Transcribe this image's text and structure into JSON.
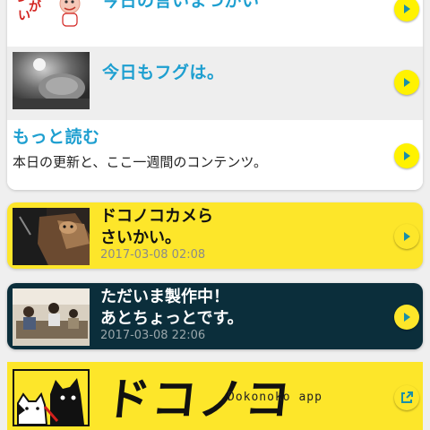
{
  "colors": {
    "accent_blue": "#1e9fd0",
    "brand_yellow": "#fde62a",
    "arrow_teal": "#1a8fa8",
    "dark_card": "#0b2e3b",
    "date_gray": "#8a8a8a"
  },
  "top_list": {
    "items": [
      {
        "title": "今日の言いまつがい",
        "thumb_text": "いまつがい",
        "icon": "chevron-right-icon"
      },
      {
        "title": "今日もフグは。",
        "icon": "chevron-right-icon"
      }
    ],
    "more": {
      "title": "もっと読む",
      "subtitle": "本日の更新と、ここ一週間のコンテンツ。",
      "icon": "chevron-right-icon"
    }
  },
  "cards": [
    {
      "title_line1": "ドコノコカメら",
      "title_line2": "さいかい。",
      "date": "2017-03-08 02:08",
      "icon": "chevron-right-icon"
    },
    {
      "title_line1": "ただいま製作中！",
      "title_line2": "あとちょっとです。",
      "date": "2017-03-08 22:06",
      "icon": "chevron-right-icon"
    }
  ],
  "banner": {
    "logo_text": "ドコノコ",
    "app_label": "Dokonoko app",
    "icon": "external-link-icon"
  }
}
